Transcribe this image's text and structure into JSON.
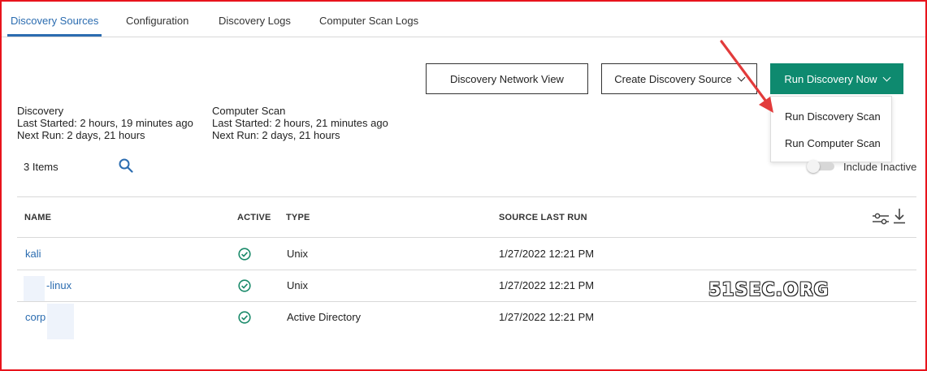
{
  "tabs": [
    {
      "label": "Discovery Sources",
      "active": true
    },
    {
      "label": "Configuration",
      "active": false
    },
    {
      "label": "Discovery Logs",
      "active": false
    },
    {
      "label": "Computer Scan Logs",
      "active": false
    }
  ],
  "toolbar": {
    "network_view_label": "Discovery Network View",
    "create_source_label": "Create Discovery Source",
    "run_now_label": "Run Discovery Now"
  },
  "run_menu": {
    "items": [
      "Run Discovery Scan",
      "Run Computer Scan"
    ]
  },
  "discovery_info": {
    "title": "Discovery",
    "last_started": "Last Started: 2 hours, 19 minutes ago",
    "next_run": "Next Run: 2 days, 21 hours"
  },
  "scan_info": {
    "title": "Computer Scan",
    "last_started": "Last Started: 2 hours, 21 minutes ago",
    "next_run": "Next Run: 2 days, 21 hours"
  },
  "list": {
    "count": "3 Items",
    "include_inactive_label": "Include Inactive",
    "include_inactive": false
  },
  "table": {
    "headers": {
      "name": "NAME",
      "active": "ACTIVE",
      "type": "TYPE",
      "last_run": "SOURCE LAST RUN"
    },
    "rows": [
      {
        "name": "kali",
        "type": "Unix",
        "last_run": "1/27/2022 12:21 PM"
      },
      {
        "name": "-linux",
        "type": "Unix",
        "last_run": "1/27/2022 12:21 PM"
      },
      {
        "name": "corp      ca",
        "type": "Active Directory",
        "last_run": "1/27/2022 12:21 PM"
      }
    ]
  },
  "watermark": "51SEC.ORG",
  "icons": {
    "search": "search-icon",
    "columns": "sliders-icon",
    "download": "download-icon",
    "active_check": "check-circle-icon",
    "annotation": "red-arrow-icon"
  },
  "colors": {
    "accent": "#2b6cb0",
    "primary_button": "#0e8a6f",
    "check": "#1a8a6a",
    "frame_border": "#e8141c",
    "arrow": "#e23b3b"
  }
}
